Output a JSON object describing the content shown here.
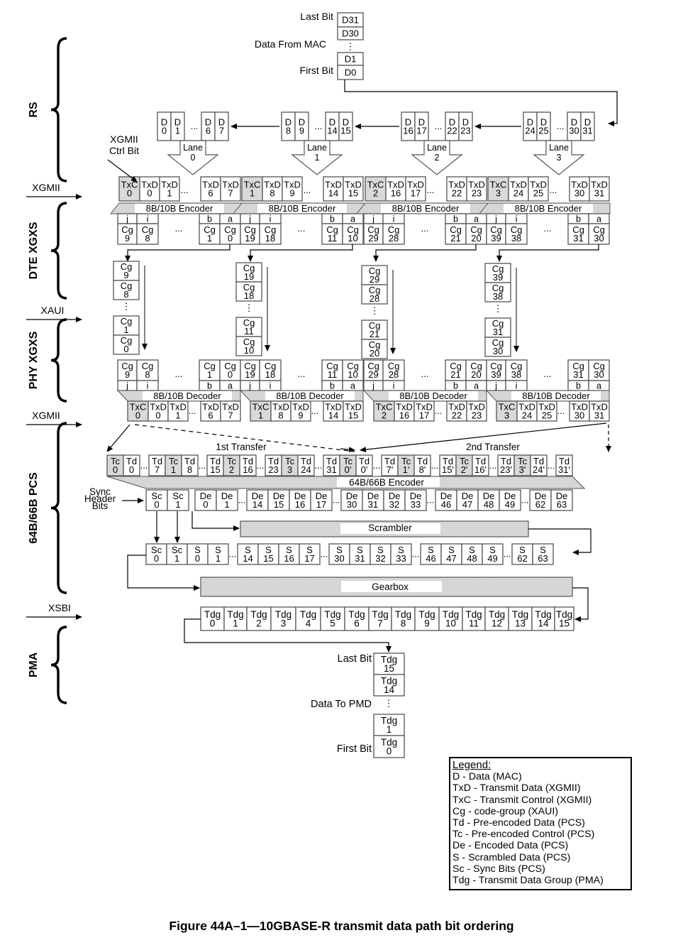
{
  "figure": {
    "caption": "Figure 44A–1—10GBASE-R transmit data path bit ordering"
  },
  "layers": [
    {
      "label": "RS"
    },
    {
      "label": "DTE XGXS"
    },
    {
      "label": "PHY XGXS"
    },
    {
      "label": "64B/66B PCS"
    },
    {
      "label": "PMA"
    }
  ],
  "interfaces": [
    {
      "label": "XGMII"
    },
    {
      "label": "XAUI"
    },
    {
      "label": "XGMII"
    },
    {
      "label": "XSBI"
    }
  ],
  "mac_input": {
    "title": "Data From MAC",
    "last_bit_label": "Last Bit",
    "first_bit_label": "First Bit",
    "bits_top": [
      "D31",
      "D30"
    ],
    "bits_bottom": [
      "D1",
      "D0"
    ]
  },
  "lanes": [
    {
      "name": "Lane 0",
      "lane_label": "Lane",
      "lane_num": "0",
      "d_cells": [
        [
          "D",
          "0"
        ],
        [
          "D",
          "1"
        ],
        [
          "D",
          "6"
        ],
        [
          "D",
          "7"
        ]
      ],
      "xgmii_cells": [
        [
          "TxC",
          "0"
        ],
        [
          "TxD",
          "0"
        ],
        [
          "TxD",
          "1"
        ],
        [
          "TxD",
          "6"
        ],
        [
          "TxD",
          "7"
        ]
      ],
      "enc_cells": [
        [
          "j",
          "Cg",
          "9"
        ],
        [
          "i",
          "Cg",
          "8"
        ],
        [
          "b",
          "Cg",
          "1"
        ],
        [
          "a",
          "Cg",
          "0"
        ]
      ],
      "xaui_stack": [
        [
          "Cg",
          "9"
        ],
        [
          "Cg",
          "8"
        ],
        [
          "Cg",
          "1"
        ],
        [
          "Cg",
          "0"
        ]
      ]
    },
    {
      "name": "Lane 1",
      "lane_label": "Lane",
      "lane_num": "1",
      "d_cells": [
        [
          "D",
          "8"
        ],
        [
          "D",
          "9"
        ],
        [
          "D",
          "14"
        ],
        [
          "D",
          "15"
        ]
      ],
      "xgmii_cells": [
        [
          "TxC",
          "1"
        ],
        [
          "TxD",
          "8"
        ],
        [
          "TxD",
          "9"
        ],
        [
          "TxD",
          "14"
        ],
        [
          "TxD",
          "15"
        ]
      ],
      "enc_cells": [
        [
          "j",
          "Cg",
          "19"
        ],
        [
          "i",
          "Cg",
          "18"
        ],
        [
          "b",
          "Cg",
          "11"
        ],
        [
          "a",
          "Cg",
          "10"
        ]
      ],
      "xaui_stack": [
        [
          "Cg",
          "19"
        ],
        [
          "Cg",
          "18"
        ],
        [
          "Cg",
          "11"
        ],
        [
          "Cg",
          "10"
        ]
      ]
    },
    {
      "name": "Lane 2",
      "lane_label": "Lane",
      "lane_num": "2",
      "d_cells": [
        [
          "D",
          "16"
        ],
        [
          "D",
          "17"
        ],
        [
          "D",
          "22"
        ],
        [
          "D",
          "23"
        ]
      ],
      "xgmii_cells": [
        [
          "TxC",
          "2"
        ],
        [
          "TxD",
          "16"
        ],
        [
          "TxD",
          "17"
        ],
        [
          "TxD",
          "22"
        ],
        [
          "TxD",
          "23"
        ]
      ],
      "enc_cells": [
        [
          "j",
          "Cg",
          "29"
        ],
        [
          "i",
          "Cg",
          "28"
        ],
        [
          "b",
          "Cg",
          "21"
        ],
        [
          "a",
          "Cg",
          "20"
        ]
      ],
      "xaui_stack": [
        [
          "Cg",
          "29"
        ],
        [
          "Cg",
          "28"
        ],
        [
          "Cg",
          "21"
        ],
        [
          "Cg",
          "20"
        ]
      ]
    },
    {
      "name": "Lane 3",
      "lane_label": "Lane",
      "lane_num": "3",
      "d_cells": [
        [
          "D",
          "24"
        ],
        [
          "D",
          "25"
        ],
        [
          "D",
          "30"
        ],
        [
          "D",
          "31"
        ]
      ],
      "xgmii_cells": [
        [
          "TxC",
          "3"
        ],
        [
          "TxD",
          "24"
        ],
        [
          "TxD",
          "25"
        ],
        [
          "TxD",
          "30"
        ],
        [
          "TxD",
          "31"
        ]
      ],
      "enc_cells": [
        [
          "j",
          "Cg",
          "39"
        ],
        [
          "i",
          "Cg",
          "38"
        ],
        [
          "b",
          "Cg",
          "31"
        ],
        [
          "a",
          "Cg",
          "30"
        ]
      ],
      "xaui_stack": [
        [
          "Cg",
          "39"
        ],
        [
          "Cg",
          "38"
        ],
        [
          "Cg",
          "31"
        ],
        [
          "Cg",
          "30"
        ]
      ]
    }
  ],
  "labels": {
    "xgmii_ctrl_bit": [
      "XGMII",
      "Ctrl Bit"
    ],
    "encoder": "8B/10B Encoder",
    "decoder": "8B/10B Decoder",
    "ellipsis": "...",
    "vdots": "⋮",
    "first_transfer": "1st Transfer",
    "second_transfer": "2nd Transfer",
    "pcs_encoder": "64B/66B Encoder",
    "sync_header": [
      "Sync",
      "Header",
      "Bits"
    ],
    "scrambler": "Scrambler",
    "gearbox": "Gearbox"
  },
  "pcs_input": [
    [
      "Tc",
      "0",
      true
    ],
    [
      "Td",
      "0",
      false
    ],
    [
      "…"
    ],
    [
      "Td",
      "7",
      false
    ],
    [
      "Tc",
      "1",
      true
    ],
    [
      "Td",
      "8",
      false
    ],
    [
      "…"
    ],
    [
      "Td",
      "15",
      false
    ],
    [
      "Tc",
      "2",
      true
    ],
    [
      "Td",
      "16",
      false
    ],
    [
      "…"
    ],
    [
      "Td",
      "23",
      false
    ],
    [
      "Tc",
      "3",
      true
    ],
    [
      "Td",
      "24",
      false
    ],
    [
      "…"
    ],
    [
      "Td",
      "31",
      false
    ],
    [
      "Tc",
      "0'",
      true
    ],
    [
      "Td",
      "0'",
      false
    ],
    [
      "…"
    ],
    [
      "Td",
      "7'",
      false
    ],
    [
      "Tc",
      "1'",
      true
    ],
    [
      "Td",
      "8'",
      false
    ],
    [
      "…"
    ],
    [
      "Td",
      "15'",
      false
    ],
    [
      "Tc",
      "2'",
      true
    ],
    [
      "Td",
      "16'",
      false
    ],
    [
      "…"
    ],
    [
      "Td",
      "23'",
      false
    ],
    [
      "Tc",
      "3'",
      true
    ],
    [
      "Td",
      "24'",
      false
    ],
    [
      "…"
    ],
    [
      "Td",
      "31'",
      false
    ]
  ],
  "pcs_encoded": {
    "sync": [
      [
        "Sc",
        "0"
      ],
      [
        "Sc",
        "1"
      ]
    ],
    "data": [
      [
        "De",
        "0"
      ],
      [
        "De",
        "1"
      ],
      [
        "…"
      ],
      [
        "De",
        "14"
      ],
      [
        "De",
        "15"
      ],
      [
        "De",
        "16"
      ],
      [
        "De",
        "17"
      ],
      [
        "…"
      ],
      [
        "De",
        "30"
      ],
      [
        "De",
        "31"
      ],
      [
        "De",
        "32"
      ],
      [
        "De",
        "33"
      ],
      [
        "…"
      ],
      [
        "De",
        "46"
      ],
      [
        "De",
        "47"
      ],
      [
        "De",
        "48"
      ],
      [
        "De",
        "49"
      ],
      [
        "…"
      ],
      [
        "De",
        "62"
      ],
      [
        "De",
        "63"
      ]
    ]
  },
  "pcs_scrambled": {
    "sync": [
      [
        "Sc",
        "0"
      ],
      [
        "Sc",
        "1"
      ]
    ],
    "data": [
      [
        "S",
        "0"
      ],
      [
        "S",
        "1"
      ],
      [
        "…"
      ],
      [
        "S",
        "14"
      ],
      [
        "S",
        "15"
      ],
      [
        "S",
        "16"
      ],
      [
        "S",
        "17"
      ],
      [
        "…"
      ],
      [
        "S",
        "30"
      ],
      [
        "S",
        "31"
      ],
      [
        "S",
        "32"
      ],
      [
        "S",
        "33"
      ],
      [
        "…"
      ],
      [
        "S",
        "46"
      ],
      [
        "S",
        "47"
      ],
      [
        "S",
        "48"
      ],
      [
        "S",
        "49"
      ],
      [
        "…"
      ],
      [
        "S",
        "62"
      ],
      [
        "S",
        "63"
      ]
    ]
  },
  "pma_groups": [
    "0",
    "1",
    "2",
    "3",
    "4",
    "5",
    "6",
    "7",
    "8",
    "9",
    "10",
    "11",
    "12",
    "13",
    "14",
    "15"
  ],
  "pma_group_prefix": "Tdg",
  "pmd_output": {
    "title": "Data To PMD",
    "last_bit_label": "Last Bit",
    "first_bit_label": "First Bit",
    "bits_top": [
      [
        "Tdg",
        "15"
      ],
      [
        "Tdg",
        "14"
      ]
    ],
    "bits_bottom": [
      [
        "Tdg",
        "1"
      ],
      [
        "Tdg",
        "0"
      ]
    ]
  },
  "legend": {
    "title": "Legend:",
    "entries": [
      "D - Data (MAC)",
      "TxD - Transmit Data (XGMII)",
      "TxC - Transmit Control (XGMII)",
      "Cg - code-group (XAUI)",
      "Td - Pre-encoded Data (PCS)",
      "Tc - Pre-encoded Control (PCS)",
      "De - Encoded Data (PCS)",
      "S - Scrambled Data (PCS)",
      "Sc - Sync Bits (PCS)",
      "Tdg - Transmit Data Group (PMA)"
    ]
  },
  "colors": {
    "control_fill": "#d9d9d9",
    "block_fill": "#dcdcdc",
    "stroke": "#555555"
  }
}
